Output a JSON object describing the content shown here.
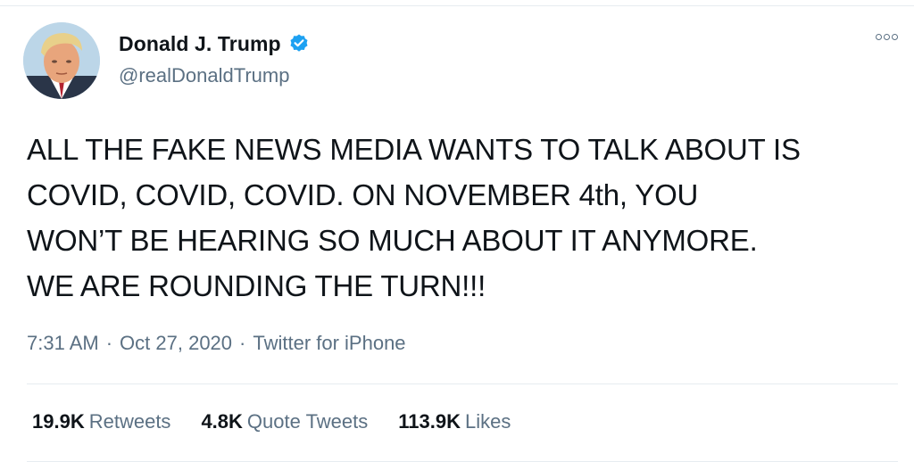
{
  "author": {
    "display_name": "Donald J. Trump",
    "handle": "@realDonaldTrump",
    "verified": true,
    "verified_color": "#1da1f2"
  },
  "tweet": {
    "text": "ALL THE FAKE NEWS MEDIA WANTS TO TALK ABOUT IS\nCOVID, COVID, COVID. ON NOVEMBER 4th, YOU\nWON’T BE HEARING SO MUCH ABOUT IT ANYMORE.\nWE ARE ROUNDING THE TURN!!!",
    "time": "7:31 AM",
    "separator": "·",
    "date": "Oct 27, 2020",
    "source": "Twitter for iPhone"
  },
  "stats": {
    "retweets_count": "19.9K",
    "retweets_label": "Retweets",
    "quote_tweets_count": "4.8K",
    "quote_tweets_label": "Quote Tweets",
    "likes_count": "113.9K",
    "likes_label": "Likes"
  },
  "icons": {
    "more": "more-options-icon",
    "verified": "verified-badge-icon"
  }
}
